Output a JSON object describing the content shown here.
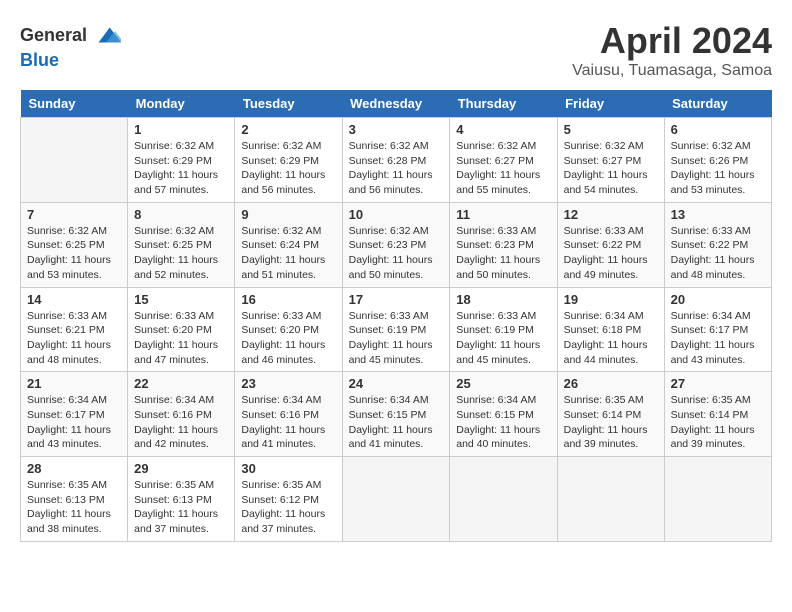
{
  "header": {
    "logo_general": "General",
    "logo_blue": "Blue",
    "month_title": "April 2024",
    "subtitle": "Vaiusu, Tuamasaga, Samoa"
  },
  "calendar": {
    "days_of_week": [
      "Sunday",
      "Monday",
      "Tuesday",
      "Wednesday",
      "Thursday",
      "Friday",
      "Saturday"
    ],
    "weeks": [
      [
        {
          "day": "",
          "info": ""
        },
        {
          "day": "1",
          "info": "Sunrise: 6:32 AM\nSunset: 6:29 PM\nDaylight: 11 hours\nand 57 minutes."
        },
        {
          "day": "2",
          "info": "Sunrise: 6:32 AM\nSunset: 6:29 PM\nDaylight: 11 hours\nand 56 minutes."
        },
        {
          "day": "3",
          "info": "Sunrise: 6:32 AM\nSunset: 6:28 PM\nDaylight: 11 hours\nand 56 minutes."
        },
        {
          "day": "4",
          "info": "Sunrise: 6:32 AM\nSunset: 6:27 PM\nDaylight: 11 hours\nand 55 minutes."
        },
        {
          "day": "5",
          "info": "Sunrise: 6:32 AM\nSunset: 6:27 PM\nDaylight: 11 hours\nand 54 minutes."
        },
        {
          "day": "6",
          "info": "Sunrise: 6:32 AM\nSunset: 6:26 PM\nDaylight: 11 hours\nand 53 minutes."
        }
      ],
      [
        {
          "day": "7",
          "info": "Sunrise: 6:32 AM\nSunset: 6:25 PM\nDaylight: 11 hours\nand 53 minutes."
        },
        {
          "day": "8",
          "info": "Sunrise: 6:32 AM\nSunset: 6:25 PM\nDaylight: 11 hours\nand 52 minutes."
        },
        {
          "day": "9",
          "info": "Sunrise: 6:32 AM\nSunset: 6:24 PM\nDaylight: 11 hours\nand 51 minutes."
        },
        {
          "day": "10",
          "info": "Sunrise: 6:32 AM\nSunset: 6:23 PM\nDaylight: 11 hours\nand 50 minutes."
        },
        {
          "day": "11",
          "info": "Sunrise: 6:33 AM\nSunset: 6:23 PM\nDaylight: 11 hours\nand 50 minutes."
        },
        {
          "day": "12",
          "info": "Sunrise: 6:33 AM\nSunset: 6:22 PM\nDaylight: 11 hours\nand 49 minutes."
        },
        {
          "day": "13",
          "info": "Sunrise: 6:33 AM\nSunset: 6:22 PM\nDaylight: 11 hours\nand 48 minutes."
        }
      ],
      [
        {
          "day": "14",
          "info": "Sunrise: 6:33 AM\nSunset: 6:21 PM\nDaylight: 11 hours\nand 48 minutes."
        },
        {
          "day": "15",
          "info": "Sunrise: 6:33 AM\nSunset: 6:20 PM\nDaylight: 11 hours\nand 47 minutes."
        },
        {
          "day": "16",
          "info": "Sunrise: 6:33 AM\nSunset: 6:20 PM\nDaylight: 11 hours\nand 46 minutes."
        },
        {
          "day": "17",
          "info": "Sunrise: 6:33 AM\nSunset: 6:19 PM\nDaylight: 11 hours\nand 45 minutes."
        },
        {
          "day": "18",
          "info": "Sunrise: 6:33 AM\nSunset: 6:19 PM\nDaylight: 11 hours\nand 45 minutes."
        },
        {
          "day": "19",
          "info": "Sunrise: 6:34 AM\nSunset: 6:18 PM\nDaylight: 11 hours\nand 44 minutes."
        },
        {
          "day": "20",
          "info": "Sunrise: 6:34 AM\nSunset: 6:17 PM\nDaylight: 11 hours\nand 43 minutes."
        }
      ],
      [
        {
          "day": "21",
          "info": "Sunrise: 6:34 AM\nSunset: 6:17 PM\nDaylight: 11 hours\nand 43 minutes."
        },
        {
          "day": "22",
          "info": "Sunrise: 6:34 AM\nSunset: 6:16 PM\nDaylight: 11 hours\nand 42 minutes."
        },
        {
          "day": "23",
          "info": "Sunrise: 6:34 AM\nSunset: 6:16 PM\nDaylight: 11 hours\nand 41 minutes."
        },
        {
          "day": "24",
          "info": "Sunrise: 6:34 AM\nSunset: 6:15 PM\nDaylight: 11 hours\nand 41 minutes."
        },
        {
          "day": "25",
          "info": "Sunrise: 6:34 AM\nSunset: 6:15 PM\nDaylight: 11 hours\nand 40 minutes."
        },
        {
          "day": "26",
          "info": "Sunrise: 6:35 AM\nSunset: 6:14 PM\nDaylight: 11 hours\nand 39 minutes."
        },
        {
          "day": "27",
          "info": "Sunrise: 6:35 AM\nSunset: 6:14 PM\nDaylight: 11 hours\nand 39 minutes."
        }
      ],
      [
        {
          "day": "28",
          "info": "Sunrise: 6:35 AM\nSunset: 6:13 PM\nDaylight: 11 hours\nand 38 minutes."
        },
        {
          "day": "29",
          "info": "Sunrise: 6:35 AM\nSunset: 6:13 PM\nDaylight: 11 hours\nand 37 minutes."
        },
        {
          "day": "30",
          "info": "Sunrise: 6:35 AM\nSunset: 6:12 PM\nDaylight: 11 hours\nand 37 minutes."
        },
        {
          "day": "",
          "info": ""
        },
        {
          "day": "",
          "info": ""
        },
        {
          "day": "",
          "info": ""
        },
        {
          "day": "",
          "info": ""
        }
      ]
    ]
  }
}
